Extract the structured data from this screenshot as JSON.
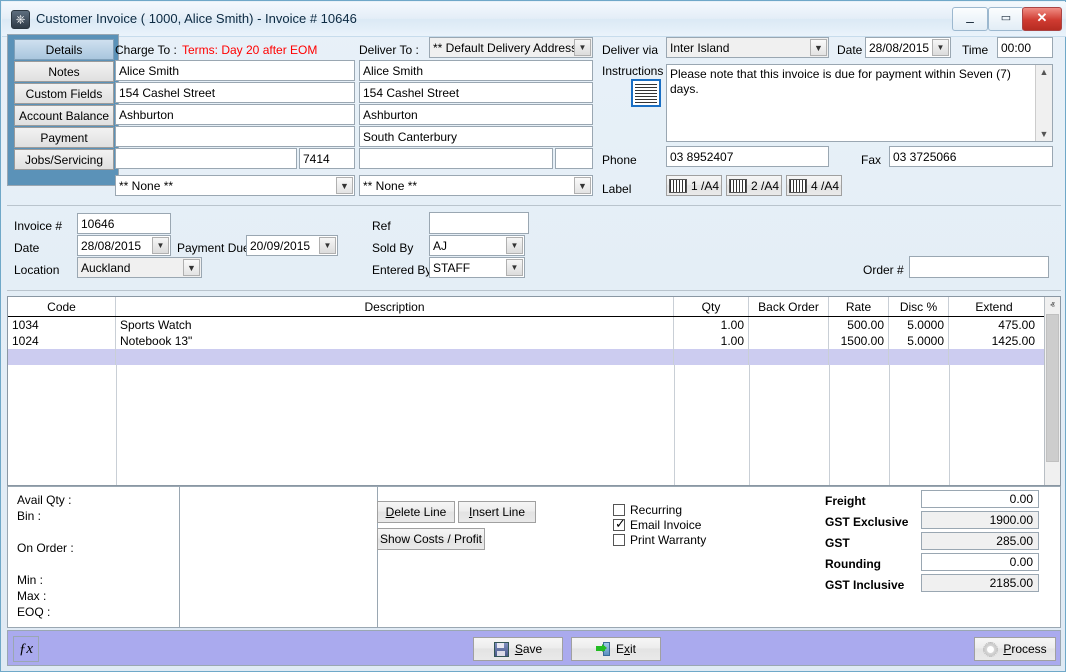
{
  "window": {
    "title": "Customer Invoice ( 1000, Alice Smith) - Invoice # 10646",
    "icon": "power-icon",
    "minimize": "–",
    "maximize": "▭",
    "close": "✕"
  },
  "sidebar": {
    "items": [
      {
        "label": "Details",
        "selected": true
      },
      {
        "label": "Notes",
        "selected": false
      },
      {
        "label": "Custom Fields",
        "selected": false
      },
      {
        "label": "Account Balance",
        "selected": false
      },
      {
        "label": "Payment",
        "selected": false
      },
      {
        "label": "Jobs/Servicing",
        "selected": false
      }
    ]
  },
  "charge_to": {
    "label": "Charge To :",
    "terms": "Terms: Day 20 after EOM",
    "terms_color": "#ff0000",
    "lines": [
      "Alice Smith",
      "154 Cashel Street",
      "Ashburton",
      ""
    ],
    "city": "",
    "postcode": "7414",
    "contact": "** None **"
  },
  "deliver_to": {
    "label": "Deliver To :",
    "address_select": "** Default Delivery Address **",
    "lines": [
      "Alice Smith",
      "154 Cashel Street",
      "Ashburton",
      "South Canterbury"
    ],
    "city": "",
    "postcode": "",
    "contact": "** None **"
  },
  "delivery": {
    "deliver_via_label": "Deliver via",
    "deliver_via_value": "Inter Island",
    "date_label": "Date",
    "date_value": "28/08/2015",
    "time_label": "Time",
    "time_value": "00:00",
    "instructions_label": "Instructions",
    "instructions_value": "Please note that this invoice is due for payment within Seven (7) days.",
    "phone_label": "Phone",
    "phone_value": "03 8952407",
    "fax_label": "Fax",
    "fax_value": "03 3725066",
    "label_label": "Label",
    "label_buttons": [
      "1 /A4",
      "2 /A4",
      "4 /A4"
    ]
  },
  "invoice": {
    "invoice_no_label": "Invoice #",
    "invoice_no_value": "10646",
    "date_label": "Date",
    "date_value": "28/08/2015",
    "payment_due_label": "Payment Due",
    "payment_due_value": "20/09/2015",
    "location_label": "Location",
    "location_value": "Auckland",
    "ref_label": "Ref",
    "ref_value": "",
    "sold_by_label": "Sold By",
    "sold_by_value": "AJ",
    "entered_by_label": "Entered By",
    "entered_by_value": "STAFF",
    "order_no_label": "Order #",
    "order_no_value": ""
  },
  "grid": {
    "columns": [
      "Code",
      "Description",
      "Qty",
      "Back Order",
      "Rate",
      "Disc %",
      "Extend"
    ],
    "rows": [
      {
        "code": "1034",
        "description": "Sports Watch",
        "qty": "1.00",
        "back_order": "",
        "rate": "500.00",
        "disc": "5.0000",
        "extend": "475.00",
        "selected": false
      },
      {
        "code": "1024",
        "description": "Notebook  13\"",
        "qty": "1.00",
        "back_order": "",
        "rate": "1500.00",
        "disc": "5.0000",
        "extend": "1425.00",
        "selected": false
      },
      {
        "code": "",
        "description": "",
        "qty": "",
        "back_order": "",
        "rate": "",
        "disc": "",
        "extend": "",
        "selected": true
      }
    ],
    "scroll_up": "ⱏ",
    "scroll_down": "ⱟ"
  },
  "stock_info": {
    "avail_qty_label": "Avail Qty :",
    "bin_label": "Bin :",
    "on_order_label": "On Order :",
    "min_label": "Min :",
    "max_label": "Max :",
    "eoq_label": "EOQ :"
  },
  "line_actions": {
    "delete_line": "Delete Line",
    "delete_line_accel": "D",
    "insert_line": "Insert Line",
    "insert_line_accel": "I",
    "show_costs": "Show Costs / Profit"
  },
  "options": [
    {
      "label": "Recurring",
      "checked": false
    },
    {
      "label": "Email Invoice",
      "checked": true
    },
    {
      "label": "Print Warranty",
      "checked": false
    }
  ],
  "totals": [
    {
      "label": "Freight",
      "value": "0.00",
      "readonly": false
    },
    {
      "label": "GST Exclusive",
      "value": "1900.00",
      "readonly": true
    },
    {
      "label": "GST",
      "value": "285.00",
      "readonly": true
    },
    {
      "label": "Rounding",
      "value": "0.00",
      "readonly": false
    },
    {
      "label": "GST Inclusive",
      "value": "2185.00",
      "readonly": true
    }
  ],
  "statusbar": {
    "fx_label": "ƒx",
    "save_label": "Save",
    "save_accel": "S",
    "exit_label": "Exit",
    "exit_accel": "x",
    "process_label": "Process",
    "process_accel": "P",
    "background": "#aaaaee"
  }
}
